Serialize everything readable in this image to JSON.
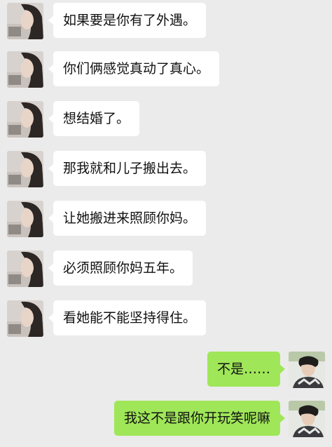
{
  "colors": {
    "background": "#ebebeb",
    "received_bubble": "#ffffff",
    "sent_bubble": "#9fe658"
  },
  "messages": [
    {
      "side": "left",
      "text": "如果要是你有了外遇。"
    },
    {
      "side": "left",
      "text": "你们俩感觉真动了真心。"
    },
    {
      "side": "left",
      "text": "想结婚了。"
    },
    {
      "side": "left",
      "text": "那我就和儿子搬出去。"
    },
    {
      "side": "left",
      "text": "让她搬进来照顾你妈。"
    },
    {
      "side": "left",
      "text": "必须照顾你妈五年。"
    },
    {
      "side": "left",
      "text": "看她能不能坚持得住。"
    },
    {
      "side": "right",
      "text": "不是……"
    },
    {
      "side": "right",
      "text": "我这不是跟你开玩笑呢嘛"
    }
  ]
}
